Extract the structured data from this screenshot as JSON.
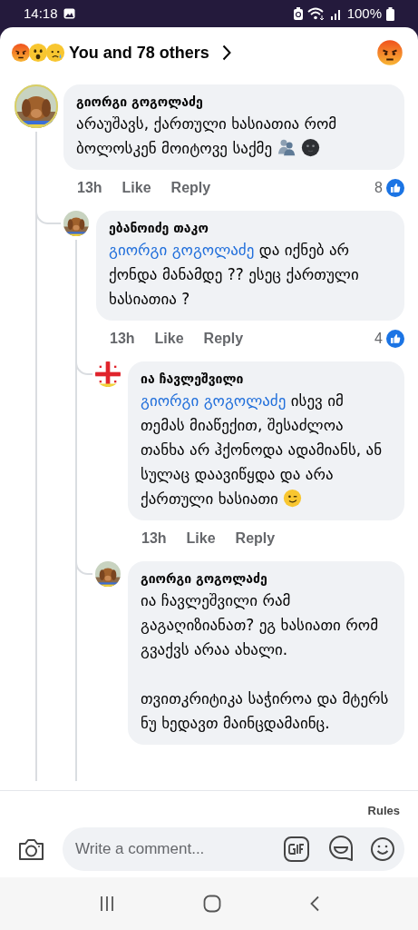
{
  "status_bar": {
    "time": "14:18",
    "battery": "100%"
  },
  "reactions_header": {
    "reactions": [
      {
        "kind": "angry"
      },
      {
        "kind": "wow"
      },
      {
        "kind": "sad"
      }
    ],
    "summary": "You and 78 others",
    "my_reaction": {
      "kind": "angry"
    }
  },
  "comments": [
    {
      "author": "გიორგი გოგოლაძე",
      "avatar": {
        "kind": "picture"
      },
      "text": "არაუშავს, ქართული ხასიათია რომ ბოლოსკენ მოიტოვე საქმე",
      "emojis": [
        {
          "kind": "people"
        },
        {
          "kind": "moon-face"
        }
      ],
      "time": "13h",
      "actions": [
        "Like",
        "Reply"
      ],
      "like_count": "8",
      "replies": [
        {
          "author": "ებანოიძე თაკო",
          "avatar": {
            "kind": "picture"
          },
          "mention": "გიორგი გოგოლაძე",
          "text": "და იქნებ არ ქონდა მანამდე ?? ესეც ქართული ხასიათია ?",
          "time": "13h",
          "actions": [
            "Like",
            "Reply"
          ],
          "like_count": "4",
          "replies": [
            {
              "author": "ია ჩავლეშვილი",
              "avatar": {
                "kind": "flag"
              },
              "mention": "გიორგი გოგოლაძე",
              "text": "ისევ იმ თემას მიაწექით, შესაძლოა თანხა არ ჰქონოდა ადამიანს, ან სულაც დაავიწყდა და არა ქართული ხასიათი",
              "emojis": [
                {
                  "kind": "wink"
                }
              ],
              "time": "13h",
              "actions": [
                "Like",
                "Reply"
              ]
            },
            {
              "author": "გიორგი გოგოლაძე",
              "avatar": {
                "kind": "picture"
              },
              "text": "ია ჩავლეშვილი რამ გაგაღიზიანათ? ეგ ხასიათი რომ გვაქვს არაა ახალი.\n\nთვითკრიტიკა საჭიროა და მტერს ნუ ხედავთ მაინცდამაინც."
            }
          ]
        }
      ]
    }
  ],
  "composer": {
    "rules": "Rules",
    "placeholder": "Write a comment..."
  }
}
